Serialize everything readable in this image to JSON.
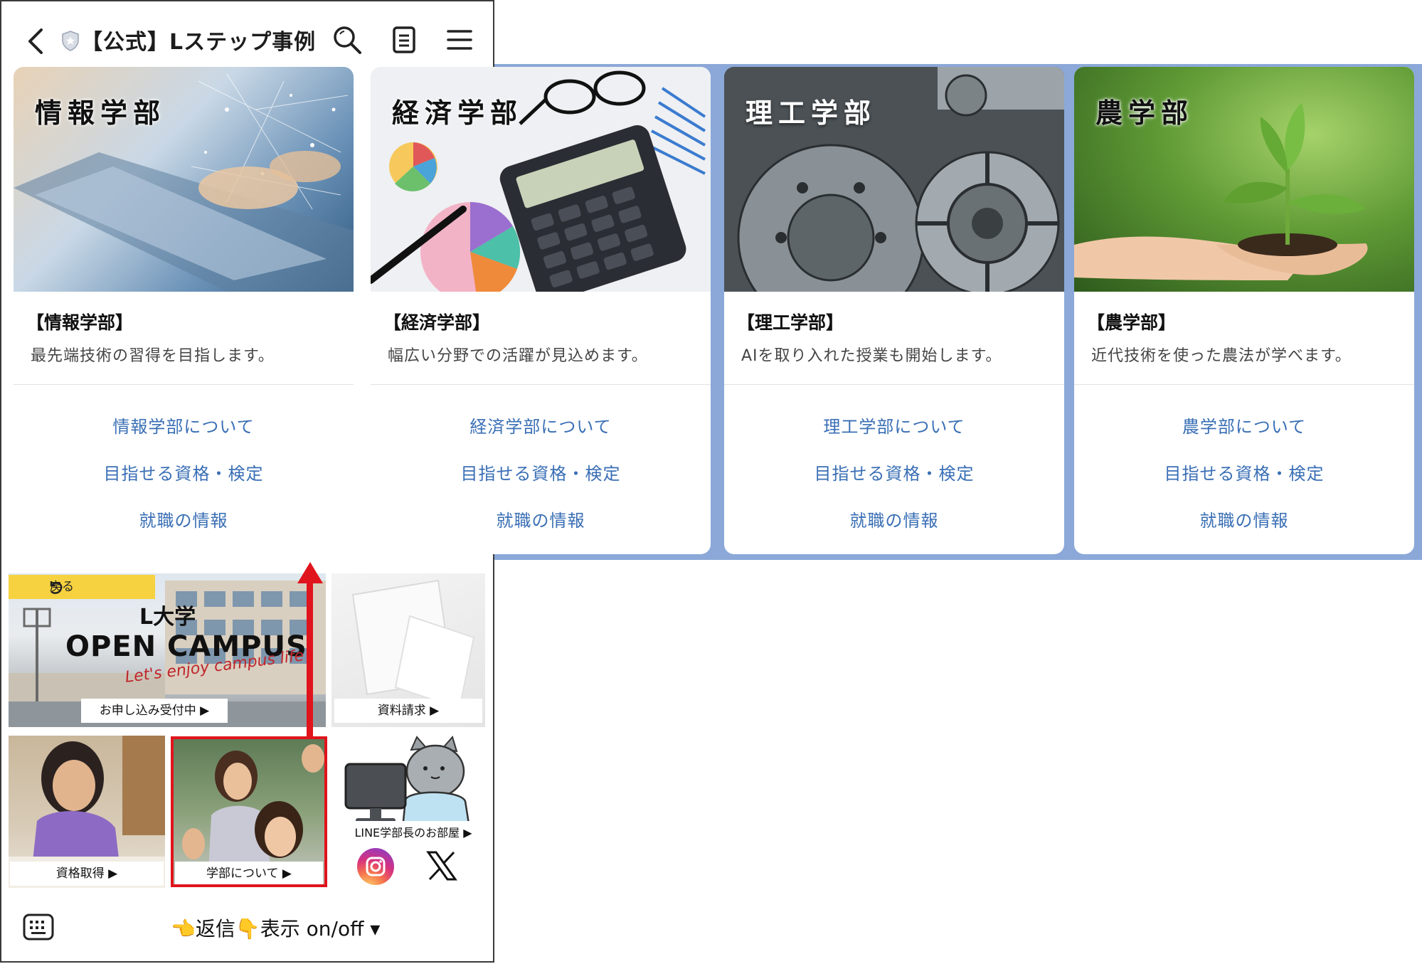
{
  "header": {
    "title": "【公式】Lステップ事例",
    "icons": [
      "back-icon",
      "shield-icon",
      "search-icon",
      "note-icon",
      "menu-icon"
    ]
  },
  "cards": [
    {
      "image_title": "情報学部",
      "heading": "【情報学部】",
      "description": "最先端技術の習得を目指します。",
      "links": [
        "情報学部について",
        "目指せる資格・検定",
        "就職の情報"
      ]
    },
    {
      "image_title": "経済学部",
      "heading": "【経済学部】",
      "description": "幅広い分野での活躍が見込めます。",
      "links": [
        "経済学部について",
        "目指せる資格・検定",
        "就職の情報"
      ]
    },
    {
      "image_title": "理工学部",
      "heading": "【理工学部】",
      "description": "AIを取り入れた授業も開始します。",
      "links": [
        "理工学部について",
        "目指せる資格・検定",
        "就職の情報"
      ]
    },
    {
      "image_title": "農学部",
      "heading": "【農学部】",
      "description": "近代技術を使った農法が学べます。",
      "links": [
        "農学部について",
        "目指せる資格・検定",
        "就職の情報"
      ]
    }
  ],
  "rich_menu": {
    "back_tag": "戻る",
    "open_campus": {
      "school": "L大学",
      "title": "OPEN CAMPUS",
      "subtitle": "Let's enjoy campus life",
      "label": "お申し込み受付中 ▶"
    },
    "documents_label": "資料請求 ▶",
    "qualification_label": "資格取得 ▶",
    "faculty_label": "学部について ▶",
    "dean_room_label": "LINE学部長のお部屋 ▶"
  },
  "bottom_bar": {
    "toggle_text": "👈返信👇表示 on/off ▾"
  },
  "colors": {
    "chat_background": "#8ba8d8",
    "link": "#3a6fb5",
    "highlight": "#e0141c",
    "tag_yellow": "#f6d240"
  }
}
